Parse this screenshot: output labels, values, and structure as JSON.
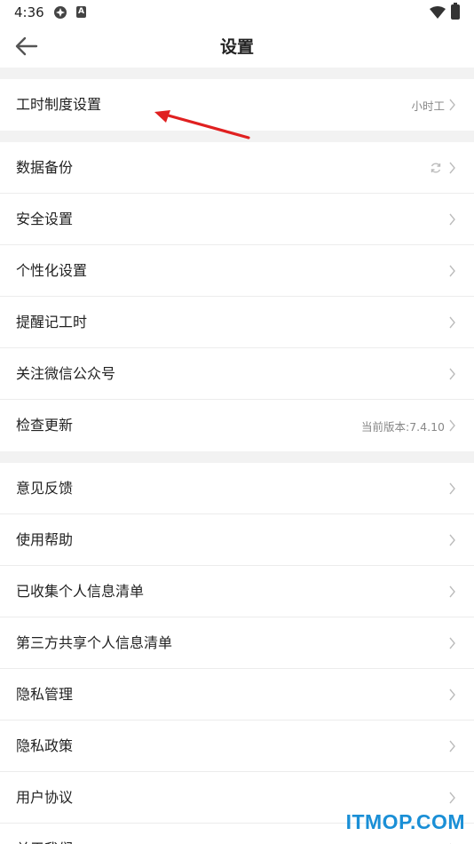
{
  "status_bar": {
    "time": "4:36",
    "b_badge": "A"
  },
  "header": {
    "title": "设置"
  },
  "sections": [
    {
      "items": [
        {
          "label": "工时制度设置",
          "value": "小时工"
        }
      ]
    },
    {
      "items": [
        {
          "label": "数据备份",
          "value": "",
          "icon": "sync-icon"
        },
        {
          "label": "安全设置",
          "value": ""
        },
        {
          "label": "个性化设置",
          "value": ""
        },
        {
          "label": "提醒记工时",
          "value": ""
        },
        {
          "label": "关注微信公众号",
          "value": ""
        },
        {
          "label": "检查更新",
          "value": "当前版本:7.4.10"
        }
      ]
    },
    {
      "items": [
        {
          "label": "意见反馈",
          "value": ""
        },
        {
          "label": "使用帮助",
          "value": ""
        },
        {
          "label": "已收集个人信息清单",
          "value": ""
        },
        {
          "label": "第三方共享个人信息清单",
          "value": ""
        },
        {
          "label": "隐私管理",
          "value": ""
        },
        {
          "label": "隐私政策",
          "value": ""
        },
        {
          "label": "用户协议",
          "value": ""
        },
        {
          "label": "关于我们",
          "value": ""
        }
      ]
    }
  ],
  "watermark": "ITMOP.COM",
  "colors": {
    "annotation_arrow": "#e02020",
    "watermark": "#1a8fd6"
  }
}
